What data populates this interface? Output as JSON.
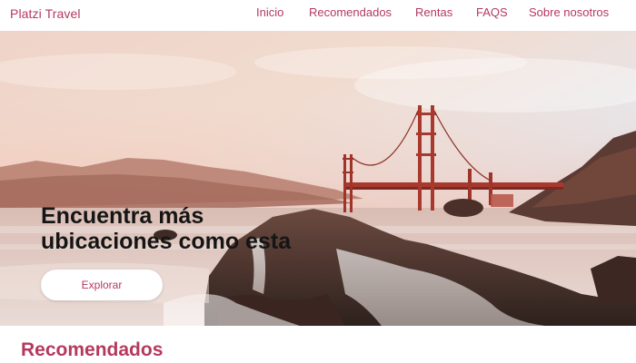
{
  "header": {
    "brand": "Platzi Travel",
    "nav": [
      {
        "label": "Inicio"
      },
      {
        "label": "Recomendados"
      },
      {
        "label": "Rentas"
      },
      {
        "label": "FAQS"
      },
      {
        "label": "Sobre nosotros"
      }
    ]
  },
  "hero": {
    "title": "Encuentra más ubicaciones como esta",
    "button_label": "Explorar"
  },
  "sections": {
    "recommended_title": "Recomendados"
  },
  "colors": {
    "brand": "#b5395f",
    "text": "#151515",
    "bridge": "#a8392e"
  }
}
